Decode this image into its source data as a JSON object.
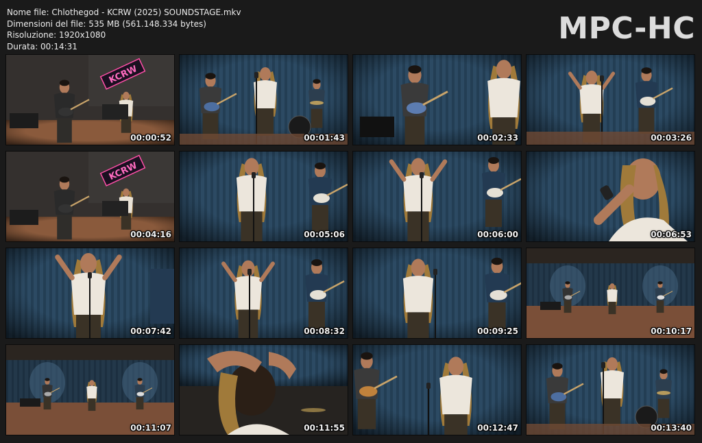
{
  "info": {
    "filename": "Nome file: Chlothegod - KCRW (2025) SOUNDSTAGE.mkv",
    "filesize": "Dimensioni del file: 535 MB (561.148.334 bytes)",
    "resolution": "Risoluzione: 1920x1080",
    "duration": "Durata: 00:14:31"
  },
  "logo": "MPC-HC",
  "thumbnails": [
    {
      "time": "00:00:52",
      "scene": "studio-wide-kcrw"
    },
    {
      "time": "00:01:43",
      "scene": "band-curtain"
    },
    {
      "time": "00:02:33",
      "scene": "bassist-singer-closeup"
    },
    {
      "time": "00:03:26",
      "scene": "singer-guitarist"
    },
    {
      "time": "00:04:16",
      "scene": "studio-wide-kcrw"
    },
    {
      "time": "00:05:06",
      "scene": "singer-guitarist-center"
    },
    {
      "time": "00:06:00",
      "scene": "singer-arms-out"
    },
    {
      "time": "00:06:53",
      "scene": "singer-closeup"
    },
    {
      "time": "00:07:42",
      "scene": "singer-medium"
    },
    {
      "time": "00:08:32",
      "scene": "singer-hand-up"
    },
    {
      "time": "00:09:25",
      "scene": "singer-profile"
    },
    {
      "time": "00:10:17",
      "scene": "stage-wide"
    },
    {
      "time": "00:11:07",
      "scene": "stage-wide"
    },
    {
      "time": "00:11:55",
      "scene": "singer-hair"
    },
    {
      "time": "00:12:47",
      "scene": "singer-bassist"
    },
    {
      "time": "00:13:40",
      "scene": "band-curtain"
    }
  ],
  "colors": {
    "background": "#1a1a1a",
    "curtain": "#2c4a63",
    "skin": "#b07a5a",
    "top": "#ece6dc"
  }
}
